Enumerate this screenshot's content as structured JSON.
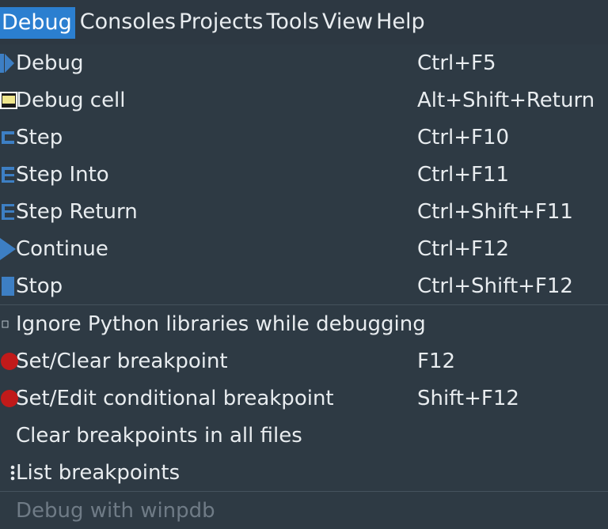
{
  "menubar": {
    "items": [
      "Debug",
      "Consoles",
      "Projects",
      "Tools",
      "View",
      "Help"
    ]
  },
  "menu": {
    "items": [
      {
        "label": "Debug",
        "shortcut": "Ctrl+F5",
        "icon": "debug-play-icon"
      },
      {
        "label": "Debug cell",
        "shortcut": "Alt+Shift+Return",
        "icon": "debug-cell-icon"
      },
      {
        "label": "Step",
        "shortcut": "Ctrl+F10",
        "icon": "step-icon"
      },
      {
        "label": "Step Into",
        "shortcut": "Ctrl+F11",
        "icon": "step-into-icon"
      },
      {
        "label": "Step Return",
        "shortcut": "Ctrl+Shift+F11",
        "icon": "step-return-icon"
      },
      {
        "label": "Continue",
        "shortcut": "Ctrl+F12",
        "icon": "continue-icon"
      },
      {
        "label": "Stop",
        "shortcut": "Ctrl+Shift+F12",
        "icon": "stop-icon"
      },
      {
        "label": "Ignore Python libraries while debugging",
        "shortcut": "",
        "icon": "checkbox-icon"
      },
      {
        "label": "Set/Clear breakpoint",
        "shortcut": "F12",
        "icon": "breakpoint-icon"
      },
      {
        "label": "Set/Edit conditional breakpoint",
        "shortcut": "Shift+F12",
        "icon": "conditional-breakpoint-icon"
      },
      {
        "label": "Clear breakpoints in all files",
        "shortcut": ""
      },
      {
        "label": "List breakpoints",
        "shortcut": "",
        "icon": "list-icon"
      },
      {
        "label": "Debug with winpdb",
        "shortcut": "",
        "disabled": true
      }
    ]
  },
  "colors": {
    "accent": "#2b7fd0",
    "menu_bg": "#2e3a44",
    "breakpoint": "#c01a1a",
    "icon_blue": "#3d7fc4"
  }
}
